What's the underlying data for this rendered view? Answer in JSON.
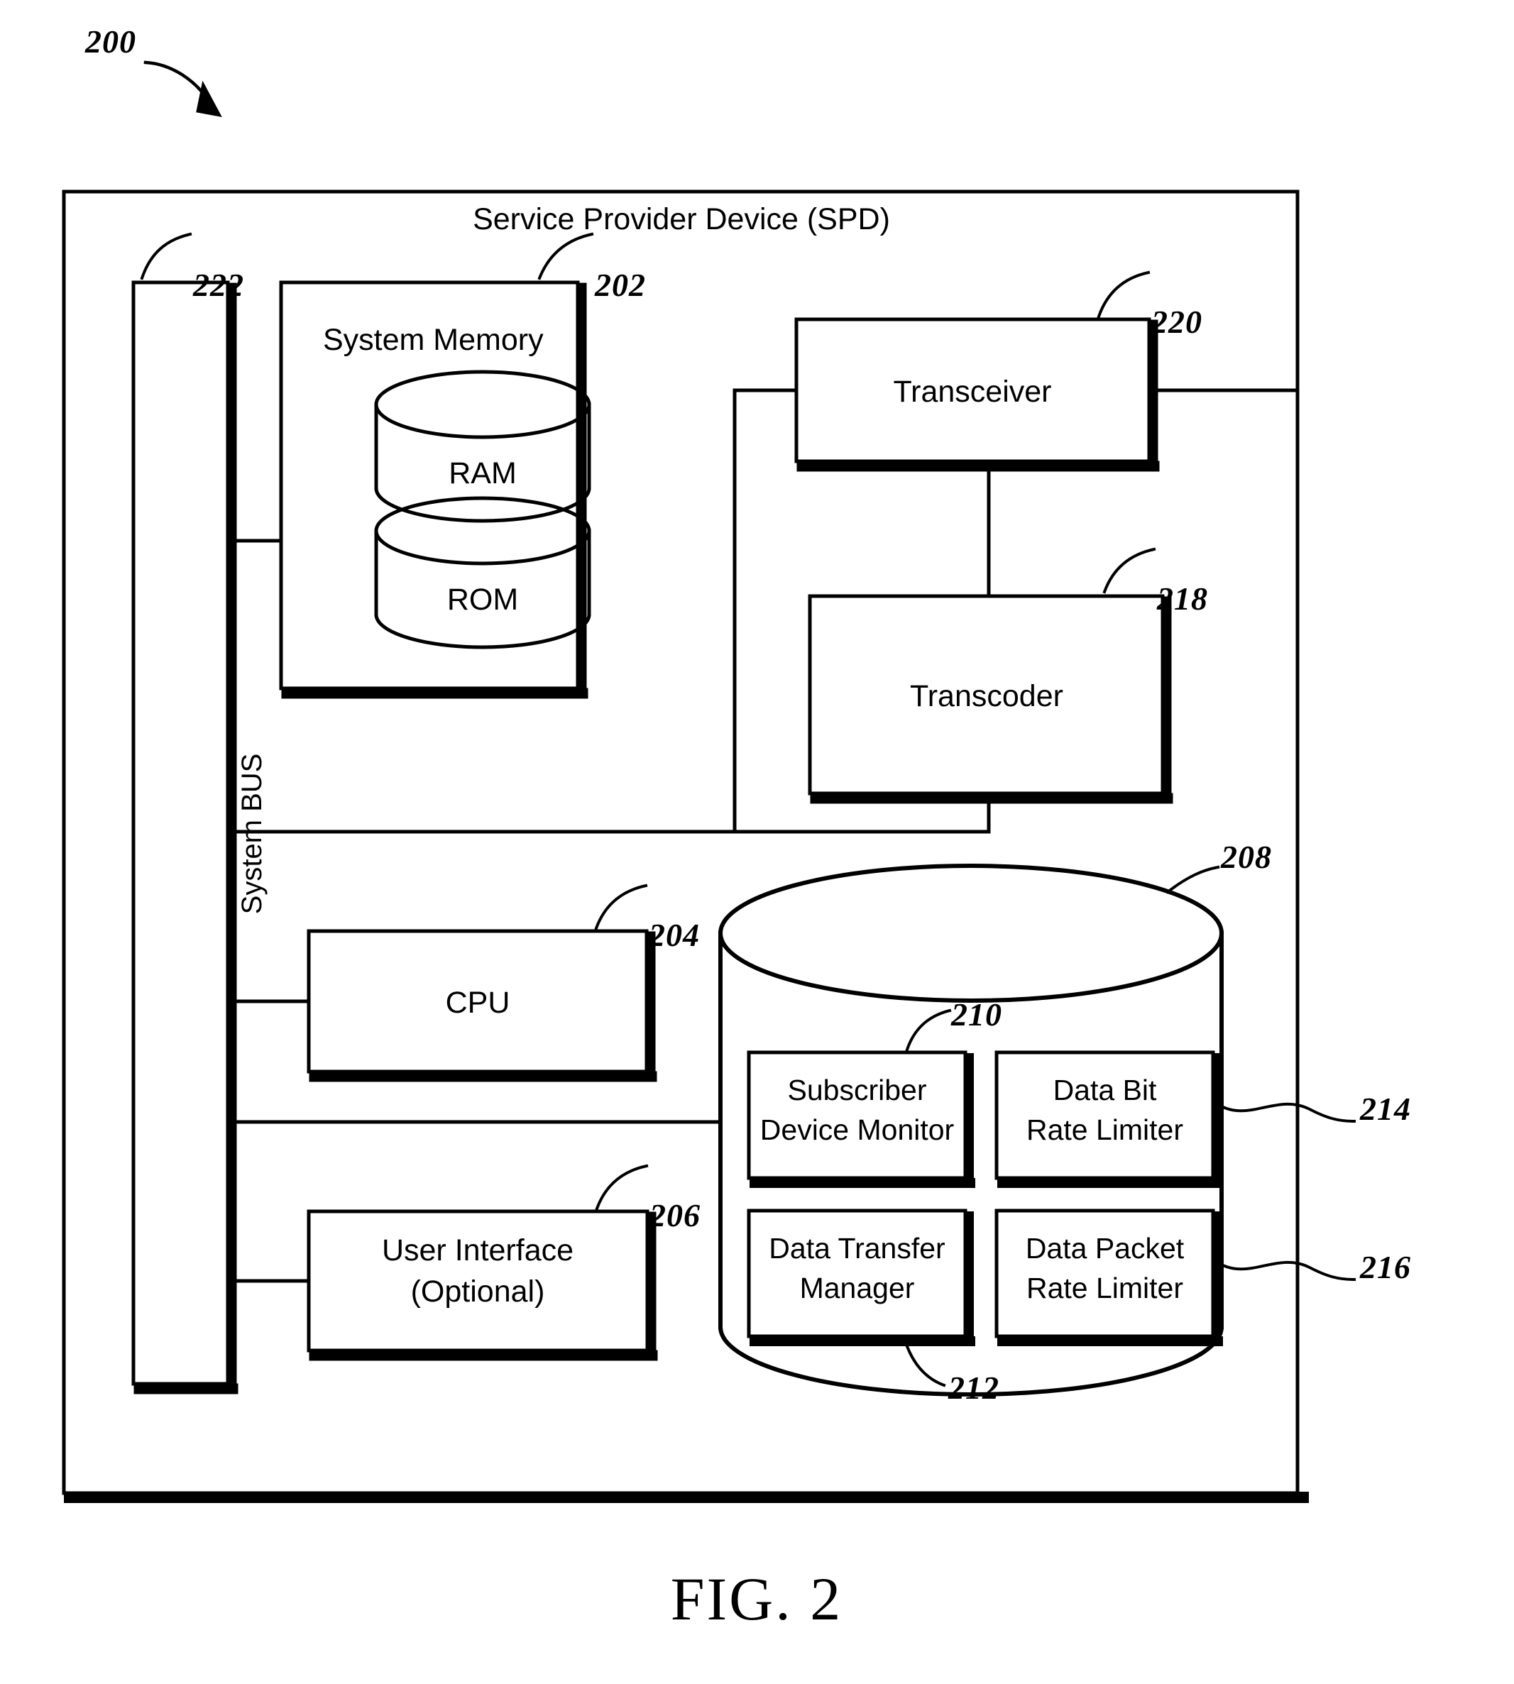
{
  "figure": {
    "number_label": "200",
    "caption": "FIG. 2",
    "outer_box_title": "Service Provider Device (SPD)"
  },
  "blocks": {
    "system_bus": {
      "label": "System BUS",
      "ref": "222"
    },
    "system_memory": {
      "label": "System Memory",
      "ref": "202",
      "ram": "RAM",
      "rom": "ROM"
    },
    "transceiver": {
      "label": "Transceiver",
      "ref": "220"
    },
    "transcoder": {
      "label": "Transcoder",
      "ref": "218"
    },
    "cpu": {
      "label": "CPU",
      "ref": "204"
    },
    "user_interface": {
      "label_line1": "User Interface",
      "label_line2": "(Optional)",
      "ref": "206"
    },
    "database": {
      "ref": "208"
    },
    "subscriber_device_monitor": {
      "label_line1": "Subscriber",
      "label_line2": "Device Monitor",
      "ref": "210"
    },
    "data_bit_rate_limiter": {
      "label_line1": "Data Bit",
      "label_line2": "Rate Limiter",
      "ref": "214"
    },
    "data_transfer_manager": {
      "label_line1": "Data Transfer",
      "label_line2": "Manager",
      "ref": "212"
    },
    "data_packet_rate_limiter": {
      "label_line1": "Data Packet",
      "label_line2": "Rate Limiter",
      "ref": "216"
    }
  },
  "style": {
    "line_color": "#000000",
    "background": "#ffffff"
  }
}
